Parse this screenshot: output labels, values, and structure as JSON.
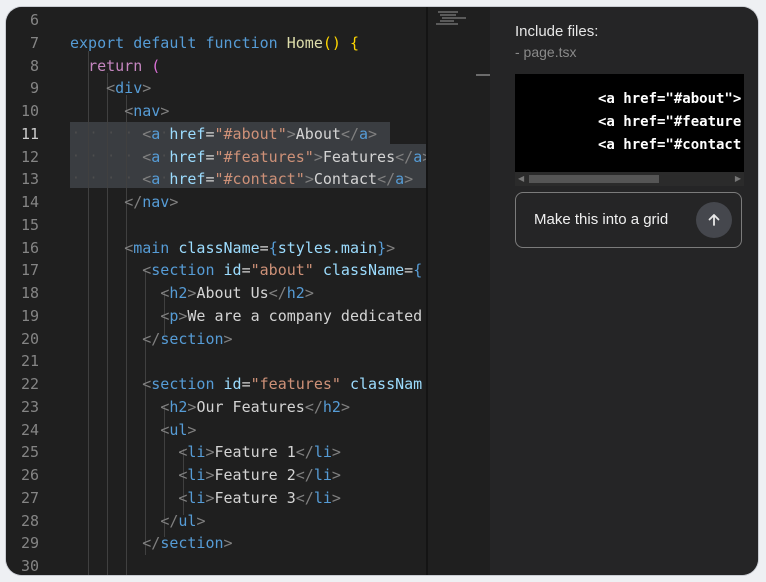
{
  "editor": {
    "lines": [
      {
        "n": "6"
      },
      {
        "n": "7"
      },
      {
        "n": "8"
      },
      {
        "n": "9"
      },
      {
        "n": "10"
      },
      {
        "n": "11"
      },
      {
        "n": "12"
      },
      {
        "n": "13"
      },
      {
        "n": "14"
      },
      {
        "n": "15"
      },
      {
        "n": "16"
      },
      {
        "n": "17"
      },
      {
        "n": "18"
      },
      {
        "n": "19"
      },
      {
        "n": "20"
      },
      {
        "n": "21"
      },
      {
        "n": "22"
      },
      {
        "n": "23"
      },
      {
        "n": "24"
      },
      {
        "n": "25"
      },
      {
        "n": "26"
      },
      {
        "n": "27"
      },
      {
        "n": "28"
      },
      {
        "n": "29"
      },
      {
        "n": "30"
      }
    ],
    "code": {
      "l7": {
        "export": "export",
        "default": "default",
        "function": "function",
        "name": "Home",
        "rest": "() {"
      },
      "l8": {
        "kw": "return",
        "paren": "("
      },
      "l9": {
        "tag": "div"
      },
      "l10": {
        "tag": "nav"
      },
      "l11": {
        "tag": "a",
        "attr": "href",
        "val": "\"#about\"",
        "text": "About"
      },
      "l12": {
        "tag": "a",
        "attr": "href",
        "val": "\"#features\"",
        "text": "Features"
      },
      "l13": {
        "tag": "a",
        "attr": "href",
        "val": "\"#contact\"",
        "text": "Contact"
      },
      "l14": {
        "tag": "nav"
      },
      "l16": {
        "tag": "main",
        "attr": "className",
        "expr": "styles.main"
      },
      "l17": {
        "tag": "section",
        "attr": "id",
        "val": "\"about\"",
        "attr2": "className"
      },
      "l18": {
        "tag": "h2",
        "text": "About Us"
      },
      "l19": {
        "tag": "p",
        "text": "We are a company dedicated"
      },
      "l20": {
        "tag": "section"
      },
      "l22": {
        "tag": "section",
        "attr": "id",
        "val": "\"features\"",
        "attr2": "classNam"
      },
      "l23": {
        "tag": "h2",
        "text": "Our Features"
      },
      "l24": {
        "tag": "ul"
      },
      "l25": {
        "tag": "li",
        "text": "Feature 1"
      },
      "l26": {
        "tag": "li",
        "text": "Feature 2"
      },
      "l27": {
        "tag": "li",
        "text": "Feature 3"
      },
      "l28": {
        "tag": "ul"
      },
      "l29": {
        "tag": "section"
      }
    }
  },
  "panel": {
    "include_label": "Include files:",
    "include_file": "- page.tsx",
    "snippet": [
      "<a href=\"#about\">",
      "<a href=\"#feature",
      "<a href=\"#contact"
    ],
    "prompt_text": "Make this into a grid"
  }
}
